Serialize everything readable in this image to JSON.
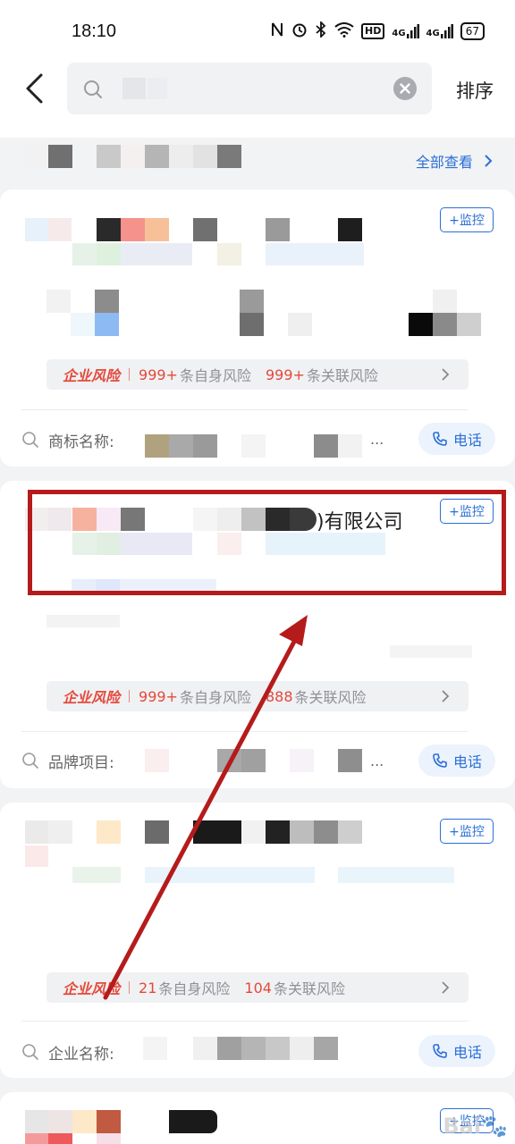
{
  "status_bar": {
    "time": "18:10",
    "icons": [
      "nfc-icon",
      "alarm-icon",
      "bluetooth-icon",
      "wifi-icon",
      "hd-icon",
      "4g-signal-icon",
      "4g-signal-icon"
    ],
    "hd_label": "HD",
    "net1_label": "4G",
    "net2_label": "4G",
    "battery": "67"
  },
  "header": {
    "search_placeholder": "",
    "sort_label": "排序"
  },
  "section": {
    "view_all_label": "全部查看"
  },
  "cards": [
    {
      "monitor_label": "+监控",
      "risk": {
        "title": "企业风险",
        "self_count": "999+",
        "self_label": "条自身风险",
        "related_count": "999+",
        "related_label": "条关联风险"
      },
      "info_label": "商标名称:",
      "info_ellipsis": "...",
      "phone_label": "电话"
    },
    {
      "monitor_label": "+监控",
      "name_suffix": ")有限公司",
      "risk": {
        "title": "企业风险",
        "self_count": "999+",
        "self_label": "条自身风险",
        "related_count": "888",
        "related_label": "条关联风险"
      },
      "info_label": "品牌项目:",
      "info_ellipsis": "...",
      "phone_label": "电话"
    },
    {
      "monitor_label": "+监控",
      "risk": {
        "title": "企业风险",
        "self_count": "21",
        "self_label": "条自身风险",
        "related_count": "104",
        "related_label": "条关联风险"
      },
      "info_label": "企业名称:",
      "phone_label": "电话"
    },
    {
      "monitor_label": "+监控"
    }
  ],
  "colors": {
    "accent_blue": "#2a6fd6",
    "risk_red": "#e4493b",
    "annotation_red": "#b51b1b"
  }
}
